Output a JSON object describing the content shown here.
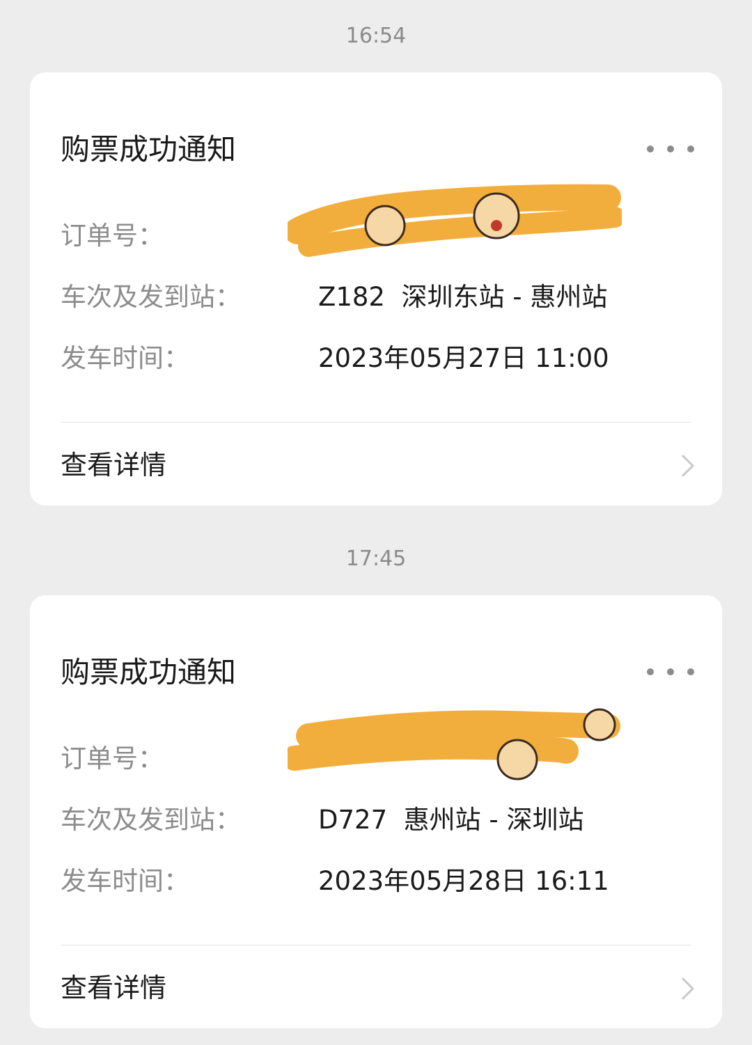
{
  "messages": [
    {
      "time": "16:54",
      "title": "购票成功通知",
      "more_icon": "more-horizontal-icon",
      "fields": [
        {
          "label": "订单号：",
          "value": ""
        },
        {
          "label": "车次及发到站：",
          "value": "Z182  深圳东站 - 惠州站"
        },
        {
          "label": "发车时间：",
          "value": "2023年05月27日 11:00"
        }
      ],
      "details_label": "查看详情",
      "chevron_icon": "chevron-right-icon"
    },
    {
      "time": "17:45",
      "title": "购票成功通知",
      "more_icon": "more-horizontal-icon",
      "fields": [
        {
          "label": "订单号：",
          "value": ""
        },
        {
          "label": "车次及发到站：",
          "value": "D727  惠州站 - 深圳站"
        },
        {
          "label": "发车时间：",
          "value": "2023年05月28日 16:11"
        }
      ],
      "details_label": "查看详情",
      "chevron_icon": "chevron-right-icon"
    }
  ],
  "colors": {
    "background": "#ededed",
    "card": "#ffffff",
    "label": "#8c8c8c",
    "value": "#1a1a1a",
    "redaction": "#f2ae3c"
  }
}
